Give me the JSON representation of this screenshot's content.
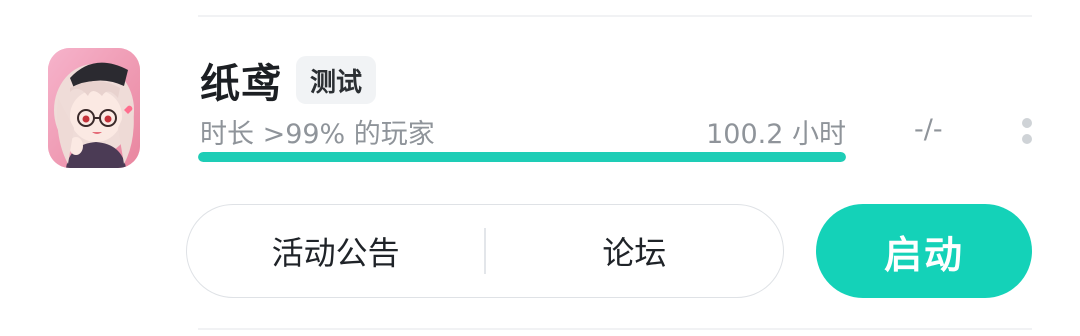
{
  "game": {
    "title": "纸鸢",
    "tag": "测试",
    "playtime_percentile": "时长 >99% 的玩家",
    "playtime": "100.2 小时",
    "playtime_progress": 1.0,
    "rank": "-/-"
  },
  "actions": {
    "announcements": "活动公告",
    "forum": "论坛",
    "launch": "启动"
  },
  "icons": {
    "more": "more-vertical-icon",
    "app": "game-app-icon"
  },
  "colors": {
    "accent": "#14d2b8",
    "progress": "#1ecdb6",
    "muted_text": "#8f949a"
  }
}
